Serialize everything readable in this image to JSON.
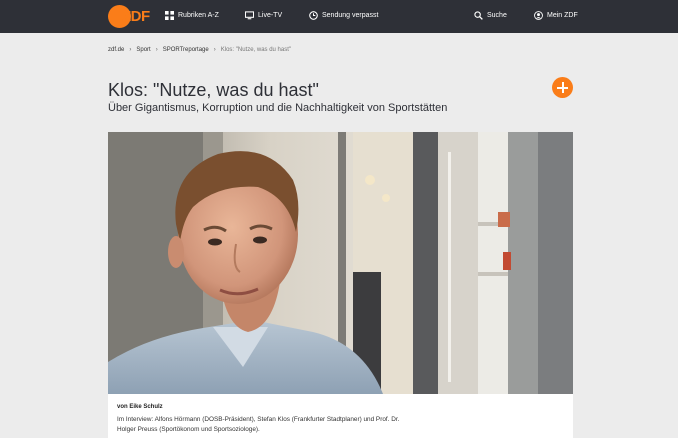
{
  "header": {
    "logo": "ZDF",
    "nav": [
      {
        "label": "Rubriken A-Z",
        "icon": "grid-icon"
      },
      {
        "label": "Live-TV",
        "icon": "tv-icon"
      },
      {
        "label": "Sendung verpasst",
        "icon": "clock-icon"
      },
      {
        "label": "Suche",
        "icon": "search-icon"
      },
      {
        "label": "Mein ZDF",
        "icon": "user-icon"
      }
    ]
  },
  "breadcrumb": [
    "zdf.de",
    "Sport",
    "SPORTreportage",
    "Klos: \"Nutze, was du hast\""
  ],
  "article": {
    "title": "Klos: \"Nutze, was du hast\"",
    "subtitle": "Über Gigantismus, Korruption und die Nachhaltigkeit von Sportstätten",
    "author": "von Eike Schulz",
    "description": "Im Interview: Alfons Hörmann (DOSB-Präsident), Stefan Klos (Frankfurter Stadtplaner) und Prof. Dr. Holger Preuss (Sportökonom und Sportsoziologe)."
  },
  "colors": {
    "topbar": "#2e3037",
    "accent": "#fa7d19",
    "background": "#ececec"
  }
}
